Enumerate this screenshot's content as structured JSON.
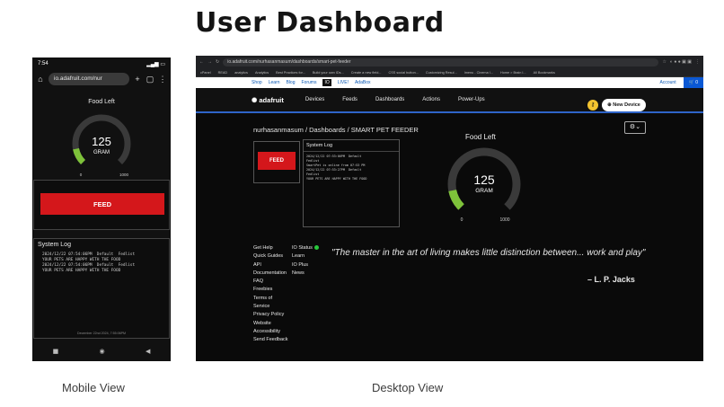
{
  "page_title": "User Dashboard",
  "captions": {
    "mobile": "Mobile View",
    "desktop": "Desktop View"
  },
  "colors": {
    "feed_red": "#d4171b",
    "gauge_green": "#7ec23a",
    "gauge_track": "#3a3a3a",
    "accent_blue": "#2f64c8",
    "status_green": "#28c83c"
  },
  "mobile": {
    "status_bar": {
      "time": "7:54"
    },
    "url": "io.adafruit.com/nur",
    "food_left_title": "Food Left",
    "gauge": {
      "value": "125",
      "unit": "GRAM",
      "min": "0",
      "max": "1000",
      "fraction": 0.125
    },
    "feed_button": "FEED",
    "system_log": {
      "title": "System Log",
      "lines": "2024/12/22 07:54:06PM  Default  Fedlist\nYOUR PETS ARE HAPPY WITH THE FOOD\n2024/12/22 07:54:06PM  Default  Fedlist\nYOUR PETS ARE HAPPY WITH THE FOOD",
      "date": "December 22nd 2024, 7:55:06PM"
    },
    "nav_icons": [
      "back-icon",
      "home-icon",
      "recents-icon"
    ]
  },
  "desktop": {
    "url": "io.adafruit.com/nurhasanmasum/dashboards/smart-pet-feeder",
    "bookmarks": [
      "cPanel",
      "READ",
      "analytics",
      "Analytics",
      "Best Practices for...",
      "Build your own IDs...",
      "Create a new field...",
      "CSS social button...",
      "Customizing Resul...",
      "Imenu - Cinema I...",
      "Home > Brain I...",
      "All Bookmarks"
    ],
    "top_nav": {
      "links": [
        "Shop",
        "Learn",
        "Blog",
        "Forums",
        "IO",
        "LIVE!",
        "AdaBox"
      ],
      "account": "Account",
      "cart": "0"
    },
    "logo": "adafruit",
    "main_nav": [
      "Devices",
      "Feeds",
      "Dashboards",
      "Actions",
      "Power-Ups"
    ],
    "new_device": "New Device",
    "breadcrumb": "nurhasanmasum / Dashboards / SMART PET FEEDER",
    "feed_button": "FEED",
    "system_log": {
      "title": "System Log",
      "lines": "2024/12/22 07:53:06PM  Default\nFedlist\nSmartPet is online from 07:53 PM\n2024/12/22 07:53:27PM  Default\nFedlist\nYOUR PETS ARE HAPPY WITH THE FOOD"
    },
    "food_left_title": "Food Left",
    "gauge": {
      "value": "125",
      "unit": "GRAM",
      "min": "0",
      "max": "1000",
      "fraction": 0.125
    },
    "footer_col1": [
      "Get Help",
      "Quick Guides",
      "API",
      "Documentation",
      "FAQ",
      "Freebies",
      "Terms of",
      "Service",
      "Privacy Policy",
      "Website",
      "Accessibility",
      "Send Feedback"
    ],
    "footer_col2": [
      "IO Status",
      "Learn",
      "IO Plus",
      "News"
    ],
    "quote": "\"The master in the art of living makes little distinction between... work and play\"",
    "quote_author": "– L. P. Jacks"
  }
}
